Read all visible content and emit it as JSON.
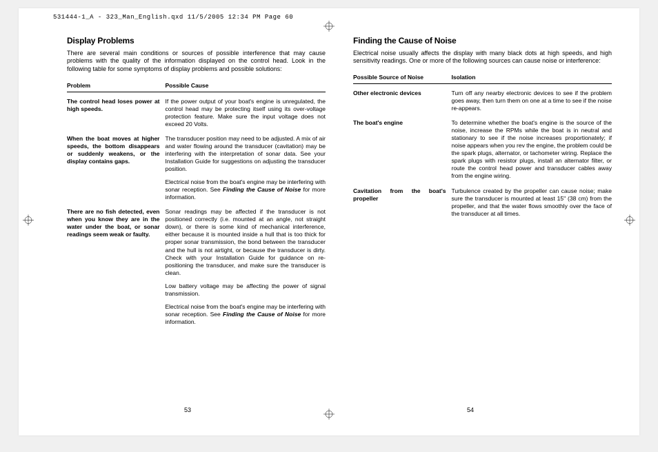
{
  "header": {
    "file_info": "531444-1_A - 323_Man_English.qxd  11/5/2005  12:34 PM  Page 60"
  },
  "left": {
    "title": "Display Problems",
    "intro": "There are several main conditions or sources of possible interference that may cause problems with the quality of the information displayed on the control head. Look in the following table for some symptoms of display problems and possible solutions:",
    "headers": {
      "col1": "Problem",
      "col2": "Possible Cause"
    },
    "rows": [
      {
        "problem": "The control head loses power at high speeds.",
        "cause": "If the power output of your boat's engine is unregulated, the control head may be protecting itself using its over-voltage protection feature. Make sure the input voltage does not exceed 20 Volts."
      },
      {
        "problem": "When the boat moves at higher speeds, the bottom disappears or suddenly weakens, or the display contains gaps.",
        "cause": "The transducer position may need to be adjusted. A mix of air and water flowing around the transducer (cavitation) may be interfering with the interpretation of sonar data. See your Installation Guide for suggestions on adjusting the transducer position.",
        "cause2_pre": "Electrical noise from the boat's engine may be interfering with sonar reception. See ",
        "cause2_ref": "Finding the Cause of Noise",
        "cause2_post": " for more information."
      },
      {
        "problem": "There are no fish detected, even when you know they are in the water under the boat, or sonar readings seem weak or faulty.",
        "cause": "Sonar readings may be affected if the transducer is not positioned correctly (i.e. mounted at an angle, not straight down), or there is some kind of mechanical interference, either because it is mounted inside a hull that is too thick for proper sonar transmission, the bond between the transducer and the hull is not airtight, or because the transducer is dirty. Check with your Installation Guide for guidance on re-positioning the transducer, and make sure the transducer is clean.",
        "cause2": "Low battery voltage may be affecting the power of signal transmission.",
        "cause3_pre": "Electrical noise from the boat's engine may be interfering with sonar reception. See ",
        "cause3_ref": "Finding the Cause of Noise",
        "cause3_post": " for more information."
      }
    ],
    "page": "53"
  },
  "right": {
    "title": "Finding the Cause of Noise",
    "intro": "Electrical noise usually affects the display with many black dots at high speeds, and high sensitivity readings. One or more of the following sources can cause noise or interference:",
    "headers": {
      "col1": "Possible Source of Noise",
      "col2": "Isolation"
    },
    "rows": [
      {
        "source": "Other electronic devices",
        "isolation": "Turn off any nearby electronic devices to see if the problem goes away, then turn them on one at a time to see if the noise re-appears."
      },
      {
        "source": "The boat's engine",
        "isolation": "To determine whether the boat's engine is the source of the noise, increase the RPMs while the boat is in neutral and stationary to see if the noise increases proportionately; if noise appears when you rev the engine, the problem could be the spark plugs, alternator, or tachometer wiring. Replace the spark plugs with resistor plugs, install an alternator filter, or route the control head power and transducer cables away from the engine wiring."
      },
      {
        "source": "Cavitation from the boat's propeller",
        "isolation": "Turbulence created by the propeller can cause noise; make sure the transducer is mounted at least 15\" (38 cm) from the propeller, and that the water flows smoothly over the face of the transducer at all times."
      }
    ],
    "page": "54"
  }
}
